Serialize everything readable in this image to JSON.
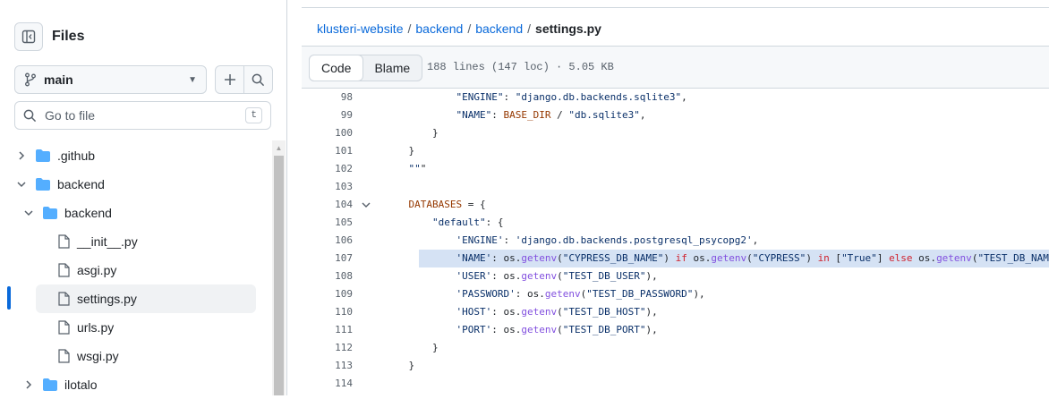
{
  "sidebar": {
    "title": "Files",
    "branch": "main",
    "goto_placeholder": "Go to file",
    "goto_shortcut": "t",
    "tree": [
      {
        "label": ".github",
        "type": "folder",
        "depth": 0,
        "expanded": false
      },
      {
        "label": "backend",
        "type": "folder",
        "depth": 0,
        "expanded": true
      },
      {
        "label": "backend",
        "type": "folder",
        "depth": 1,
        "expanded": true
      },
      {
        "label": "__init__.py",
        "type": "file",
        "depth": 2
      },
      {
        "label": "asgi.py",
        "type": "file",
        "depth": 2
      },
      {
        "label": "settings.py",
        "type": "file",
        "depth": 2,
        "active": true
      },
      {
        "label": "urls.py",
        "type": "file",
        "depth": 2
      },
      {
        "label": "wsgi.py",
        "type": "file",
        "depth": 2
      },
      {
        "label": "ilotalo",
        "type": "folder",
        "depth": 1,
        "expanded": false
      }
    ]
  },
  "breadcrumb": {
    "repo": "klusteri-website",
    "dir1": "backend",
    "dir2": "backend",
    "file": "settings.py",
    "sep": "/"
  },
  "toolbar": {
    "code_tab": "Code",
    "blame_tab": "Blame",
    "file_info": "188 lines (147 loc) · 5.05 KB"
  },
  "code": {
    "highlighted_line": 107,
    "lines": [
      {
        "n": "98",
        "text": "            \"ENGINE\": \"django.db.backends.sqlite3\","
      },
      {
        "n": "99",
        "text": "            \"NAME\": BASE_DIR / \"db.sqlite3\","
      },
      {
        "n": "100",
        "text": "        }"
      },
      {
        "n": "101",
        "text": "    }"
      },
      {
        "n": "102",
        "text": "    \"\"\""
      },
      {
        "n": "103",
        "text": ""
      },
      {
        "n": "104",
        "text": "    DATABASES = {",
        "fold": true
      },
      {
        "n": "105",
        "text": "        \"default\": {"
      },
      {
        "n": "106",
        "text": "            'ENGINE': 'django.db.backends.postgresql_psycopg2',"
      },
      {
        "n": "107",
        "text": "            'NAME': os.getenv(\"CYPRESS_DB_NAME\") if os.getenv(\"CYPRESS\") in [\"True\"] else os.getenv(\"TEST_DB_NAME\"),"
      },
      {
        "n": "108",
        "text": "            'USER': os.getenv(\"TEST_DB_USER\"),"
      },
      {
        "n": "109",
        "text": "            'PASSWORD': os.getenv(\"TEST_DB_PASSWORD\"),"
      },
      {
        "n": "110",
        "text": "            'HOST': os.getenv(\"TEST_DB_HOST\"),"
      },
      {
        "n": "111",
        "text": "            'PORT': os.getenv(\"TEST_DB_PORT\"),"
      },
      {
        "n": "112",
        "text": "        }"
      },
      {
        "n": "113",
        "text": "    }"
      },
      {
        "n": "114",
        "text": ""
      }
    ]
  },
  "colors": {
    "link": "#0969da",
    "folder": "#54aeff",
    "highlight": "#d5e2f4",
    "keyword": "#cf222e",
    "function": "#8250df",
    "string": "#0a3069"
  }
}
